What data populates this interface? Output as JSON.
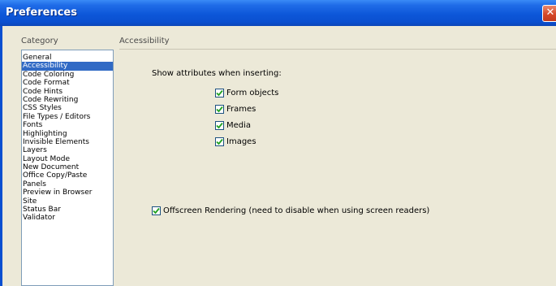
{
  "window": {
    "title": "Preferences",
    "close_glyph": "✕"
  },
  "category_panel": {
    "header": "Category",
    "items": [
      "General",
      "Accessibility",
      "Code Coloring",
      "Code Format",
      "Code Hints",
      "Code Rewriting",
      "CSS Styles",
      "File Types / Editors",
      "Fonts",
      "Highlighting",
      "Invisible Elements",
      "Layers",
      "Layout Mode",
      "New Document",
      "Office Copy/Paste",
      "Panels",
      "Preview in Browser",
      "Site",
      "Status Bar",
      "Validator"
    ],
    "selected_index": 1
  },
  "accessibility": {
    "header": "Accessibility",
    "show_attributes_label": "Show attributes when inserting:",
    "options": [
      {
        "label": "Form objects",
        "checked": true
      },
      {
        "label": "Frames",
        "checked": true
      },
      {
        "label": "Media",
        "checked": true
      },
      {
        "label": "Images",
        "checked": true
      }
    ],
    "offscreen": {
      "label": "Offscreen Rendering (need to disable when using screen readers)",
      "checked": true
    }
  },
  "colors": {
    "titlebar": "#0a4fd0",
    "selection": "#316ac5",
    "check": "#21a121",
    "dialog_bg": "#ece9d8"
  }
}
